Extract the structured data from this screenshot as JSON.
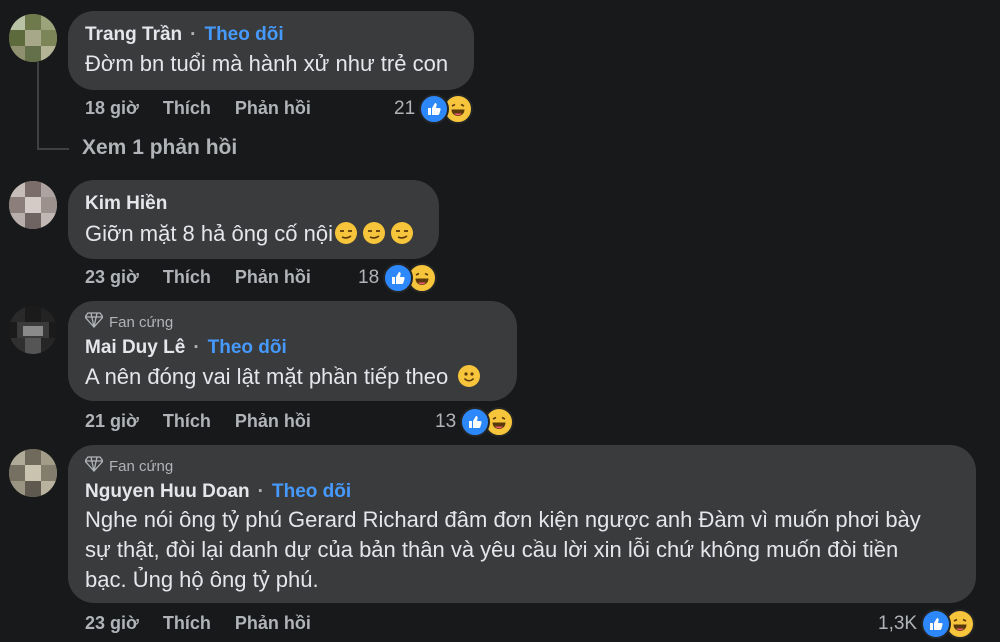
{
  "comments": [
    {
      "name": "Trang Trần",
      "separator": "·",
      "follow": "Theo dõi",
      "text": "Đờm bn tuổi mà hành xử như trẻ con",
      "time": "18 giờ",
      "like": "Thích",
      "reply": "Phản hồi",
      "reaction_count": "21"
    },
    {
      "name": "Kim Hiền",
      "text": "Giỡn mặt 8 hả ông cố nội",
      "time": "23 giờ",
      "like": "Thích",
      "reply": "Phản hồi",
      "reaction_count": "18"
    },
    {
      "badge": "Fan cứng",
      "name": "Mai Duy Lê",
      "separator": "·",
      "follow": "Theo dõi",
      "text": "A nên đóng vai lật mặt phần tiếp theo",
      "time": "21 giờ",
      "like": "Thích",
      "reply": "Phản hồi",
      "reaction_count": "13"
    },
    {
      "badge": "Fan cứng",
      "name": "Nguyen Huu Doan",
      "separator": "·",
      "follow": "Theo dõi",
      "text_lines": [
        "Nghe nói ông tỷ phú Gerard Richard đâm đơn kiện ngược anh Đàm vì muốn phơi bày",
        "sự thật, đòi lại danh dự của bản thân và yêu cầu lời xin lỗi chứ không muốn đòi tiền",
        "bạc. Ủng hộ ông tỷ phú."
      ],
      "time": "23 giờ",
      "like": "Thích",
      "reply": "Phản hồi",
      "reaction_count": "1,3K"
    }
  ],
  "view_replies": "Xem 1 phản hồi",
  "icons": [
    "like-reaction-icon",
    "haha-reaction-icon",
    "smirk-emoji-icon",
    "smile-emoji-icon",
    "diamond-icon"
  ],
  "colors": {
    "background": "#18191a",
    "bubble": "#3a3b3c",
    "follow": "#4599ff",
    "like": "#2d88ff",
    "haha": "#f7c53b"
  }
}
